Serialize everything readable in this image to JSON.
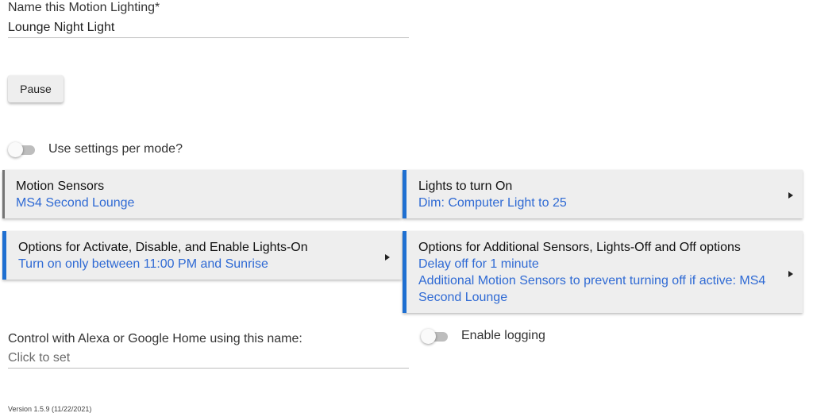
{
  "name_field": {
    "label": "Name this Motion Lighting*",
    "value": "Lounge Night Light"
  },
  "pause_button": {
    "label": "Pause"
  },
  "mode_toggle": {
    "label": "Use settings per mode?",
    "on": false
  },
  "cards": {
    "motion_sensors": {
      "title": "Motion Sensors",
      "lines": [
        "MS4 Second Lounge"
      ]
    },
    "lights_on": {
      "title": "Lights to turn On",
      "lines": [
        "Dim: Computer Light to 25"
      ]
    },
    "activate_options": {
      "title": "Options for Activate, Disable, and Enable Lights-On",
      "lines": [
        "Turn on only between 11:00 PM and Sunrise"
      ]
    },
    "additional_options": {
      "title": "Options for Additional Sensors, Lights-Off and Off options",
      "lines": [
        "Delay off for 1 minute",
        "Additional Motion Sensors to prevent turning off if active: MS4",
        "Second Lounge"
      ]
    }
  },
  "voice_field": {
    "label": "Control with Alexa or Google Home using this name:",
    "placeholder": "Click to set"
  },
  "logging_toggle": {
    "label": "Enable logging",
    "on": false
  },
  "version": "Version 1.5.9 (11/22/2021)",
  "colors": {
    "accent": "#1e6fd1",
    "link_text": "#2f6ad4",
    "card_bg": "#eeeeee"
  }
}
